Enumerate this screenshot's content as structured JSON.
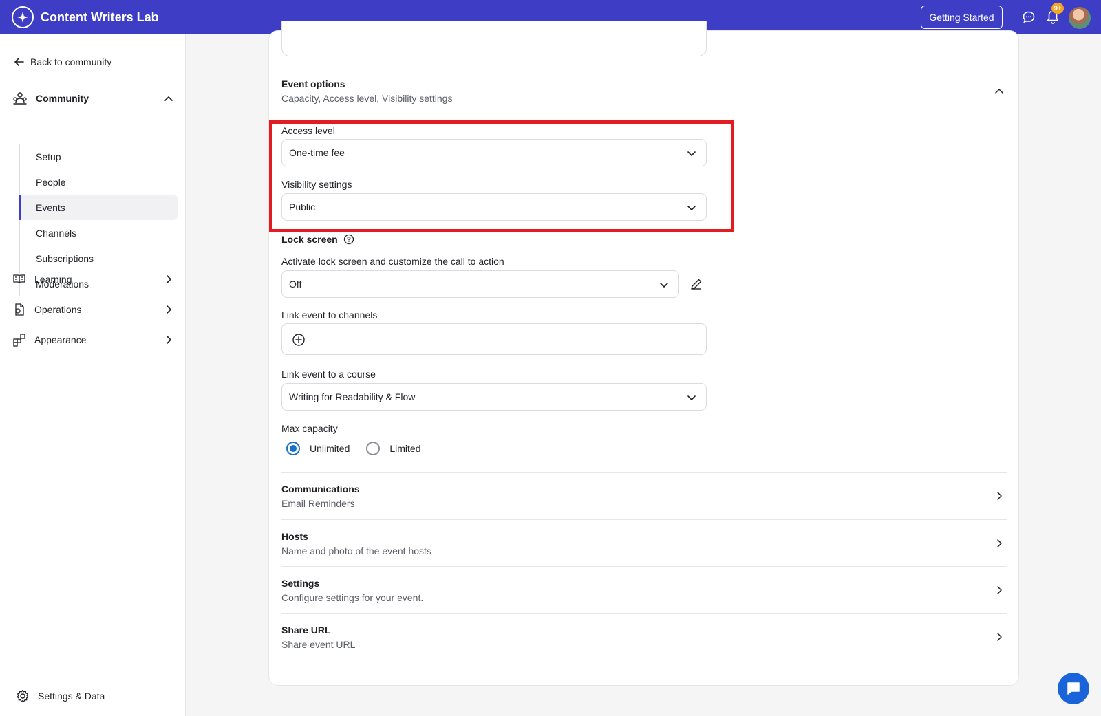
{
  "app": {
    "title": "Content Writers Lab",
    "getting_started": "Getting Started",
    "notification_badge": "9+"
  },
  "sidebar": {
    "back_label": "Back to community",
    "community": {
      "label": "Community",
      "items": [
        "Setup",
        "People",
        "Events",
        "Channels",
        "Subscriptions",
        "Moderations"
      ],
      "active": "Events"
    },
    "groups": [
      {
        "label": "Learning"
      },
      {
        "label": "Operations"
      },
      {
        "label": "Appearance"
      }
    ],
    "footer_label": "Settings & Data"
  },
  "event_options": {
    "title": "Event options",
    "subtitle": "Capacity, Access level, Visibility settings",
    "access_level": {
      "label": "Access level",
      "value": "One-time fee"
    },
    "visibility": {
      "label": "Visibility settings",
      "value": "Public"
    },
    "lock_screen": {
      "title": "Lock screen",
      "label": "Activate lock screen and customize the call to action",
      "value": "Off"
    },
    "link_channels": {
      "label": "Link event to channels"
    },
    "link_course": {
      "label": "Link event to a course",
      "value": "Writing for Readability & Flow"
    },
    "max_capacity": {
      "label": "Max capacity",
      "options": [
        "Unlimited",
        "Limited"
      ],
      "selected": "Unlimited"
    }
  },
  "sections": [
    {
      "title": "Communications",
      "subtitle": "Email Reminders"
    },
    {
      "title": "Hosts",
      "subtitle": "Name and photo of the event hosts"
    },
    {
      "title": "Settings",
      "subtitle": "Configure settings for your event."
    },
    {
      "title": "Share URL",
      "subtitle": "Share event URL"
    }
  ],
  "colors": {
    "brand": "#3d3dc6",
    "highlight": "#e31b23",
    "radio_checked": "#1a73c8",
    "badge": "#f6a623",
    "chat_fab": "#1864d8"
  }
}
